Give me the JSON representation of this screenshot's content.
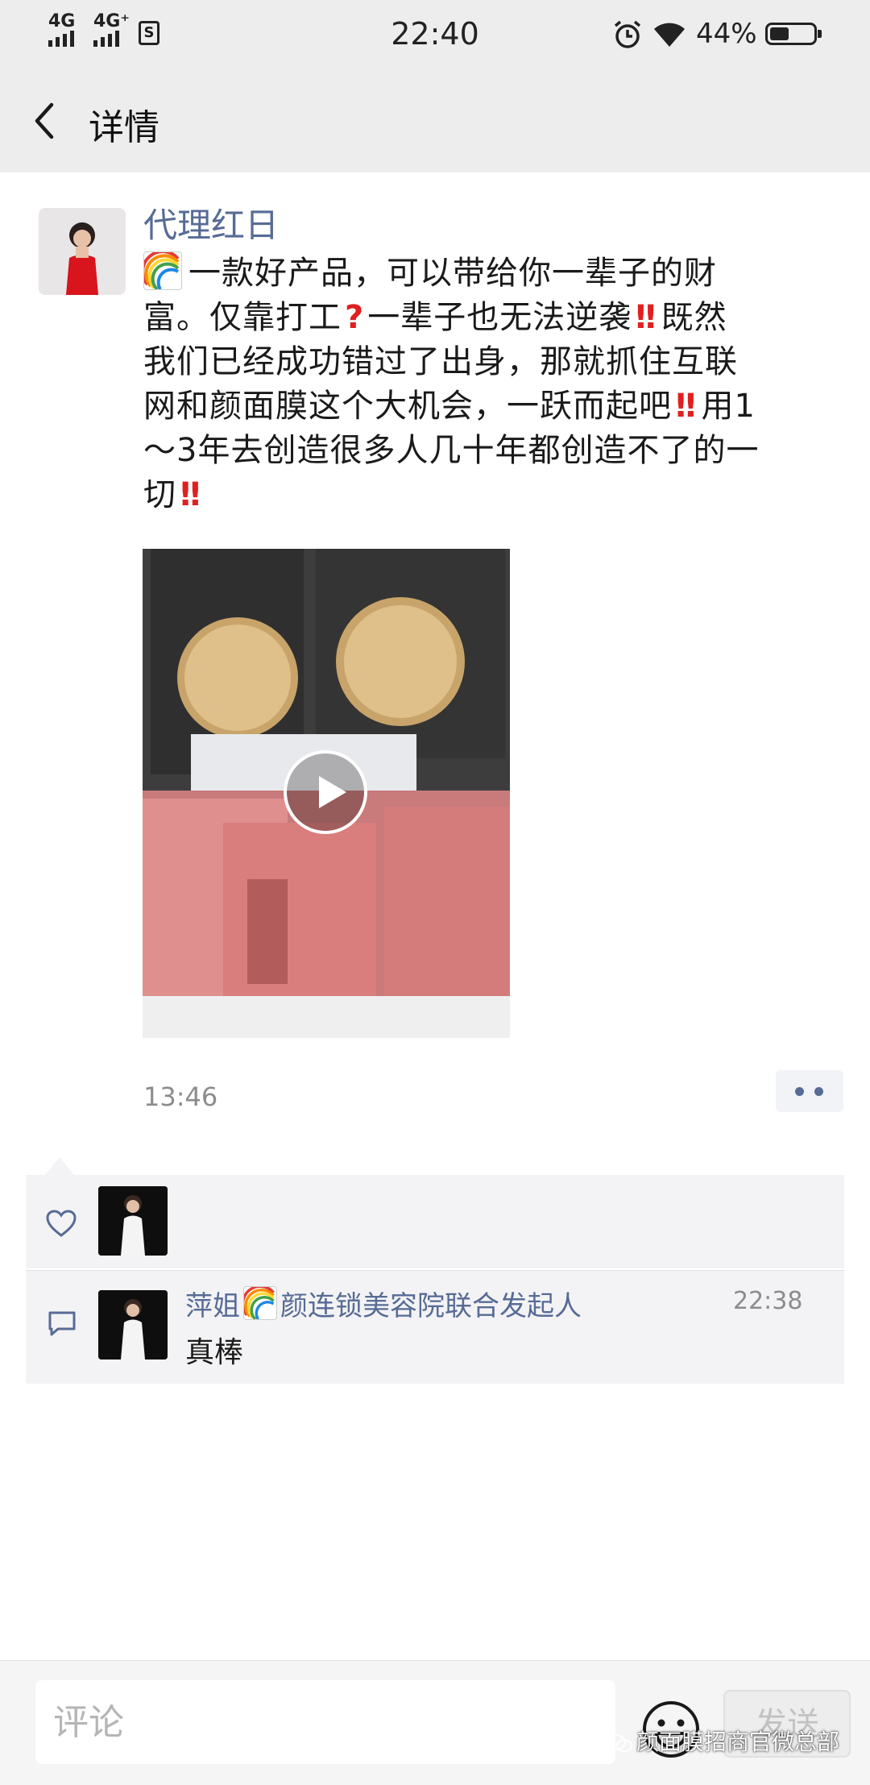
{
  "status_bar": {
    "signal_1": "4G",
    "signal_2": "4G⁺",
    "sim_icon": "S",
    "time": "22:40",
    "battery_percent": "44%",
    "battery_level": 0.44,
    "icons": [
      "signal-icon",
      "sim-icon",
      "alarm-icon",
      "wifi-icon",
      "battery-icon"
    ]
  },
  "header": {
    "title": "详情",
    "back_icon": "chevron-left-icon"
  },
  "post": {
    "author": "代理红日",
    "text_lines": [
      "一款好产品，可以带给你一辈子的财",
      "富。仅靠打工",
      "一辈子也无法逆袭",
      "既然",
      "我们已经成功错过了出身，那就抓住互联",
      "网和颜面膜这个大机会，一跃而起吧",
      "用1",
      "～3年去创造很多人几十年都创造不了的一",
      "切"
    ],
    "time": "13:46",
    "video_icon": "play-icon"
  },
  "likes": {
    "icon": "heart-icon"
  },
  "comments": [
    {
      "name_before": "萍姐",
      "name_after": "颜连锁美容院联合发起人",
      "time": "22:38",
      "text": "真棒"
    }
  ],
  "input_bar": {
    "placeholder": "评论",
    "send_label": "发送"
  },
  "watermark": "颜面膜招商官微总部",
  "colors": {
    "link": "#576b95",
    "bar_bg": "#ededed",
    "interaction_bg": "#f3f3f5",
    "accent_red": "#e02020"
  }
}
